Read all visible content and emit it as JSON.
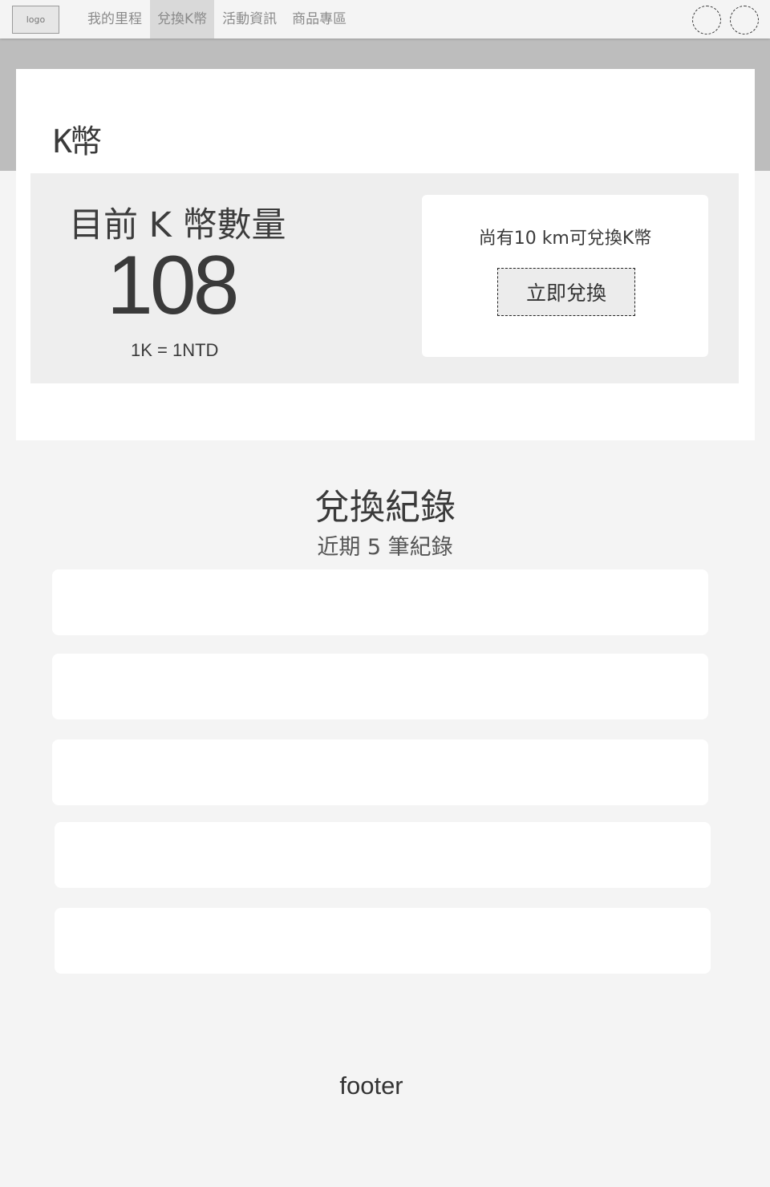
{
  "navbar": {
    "logo": "logo",
    "links": [
      {
        "label": "我的里程"
      },
      {
        "label": "兌換K幣",
        "active": true
      },
      {
        "label": "活動資訊"
      },
      {
        "label": "商品專區"
      }
    ],
    "circle_buttons": 2
  },
  "card": {
    "title": "K幣",
    "coin_label": "目前 K 幣數量",
    "coin_amount": "108",
    "rate": "1K = 1NTD",
    "exchange_info": "尚有10 km可兌換K幣",
    "exchange_button": "立即兌換"
  },
  "records": {
    "title": "兌換紀錄",
    "subtitle": "近期 5 筆紀錄",
    "rows": [
      "",
      "",
      "",
      "",
      ""
    ]
  },
  "footer": {
    "text": "footer"
  }
}
